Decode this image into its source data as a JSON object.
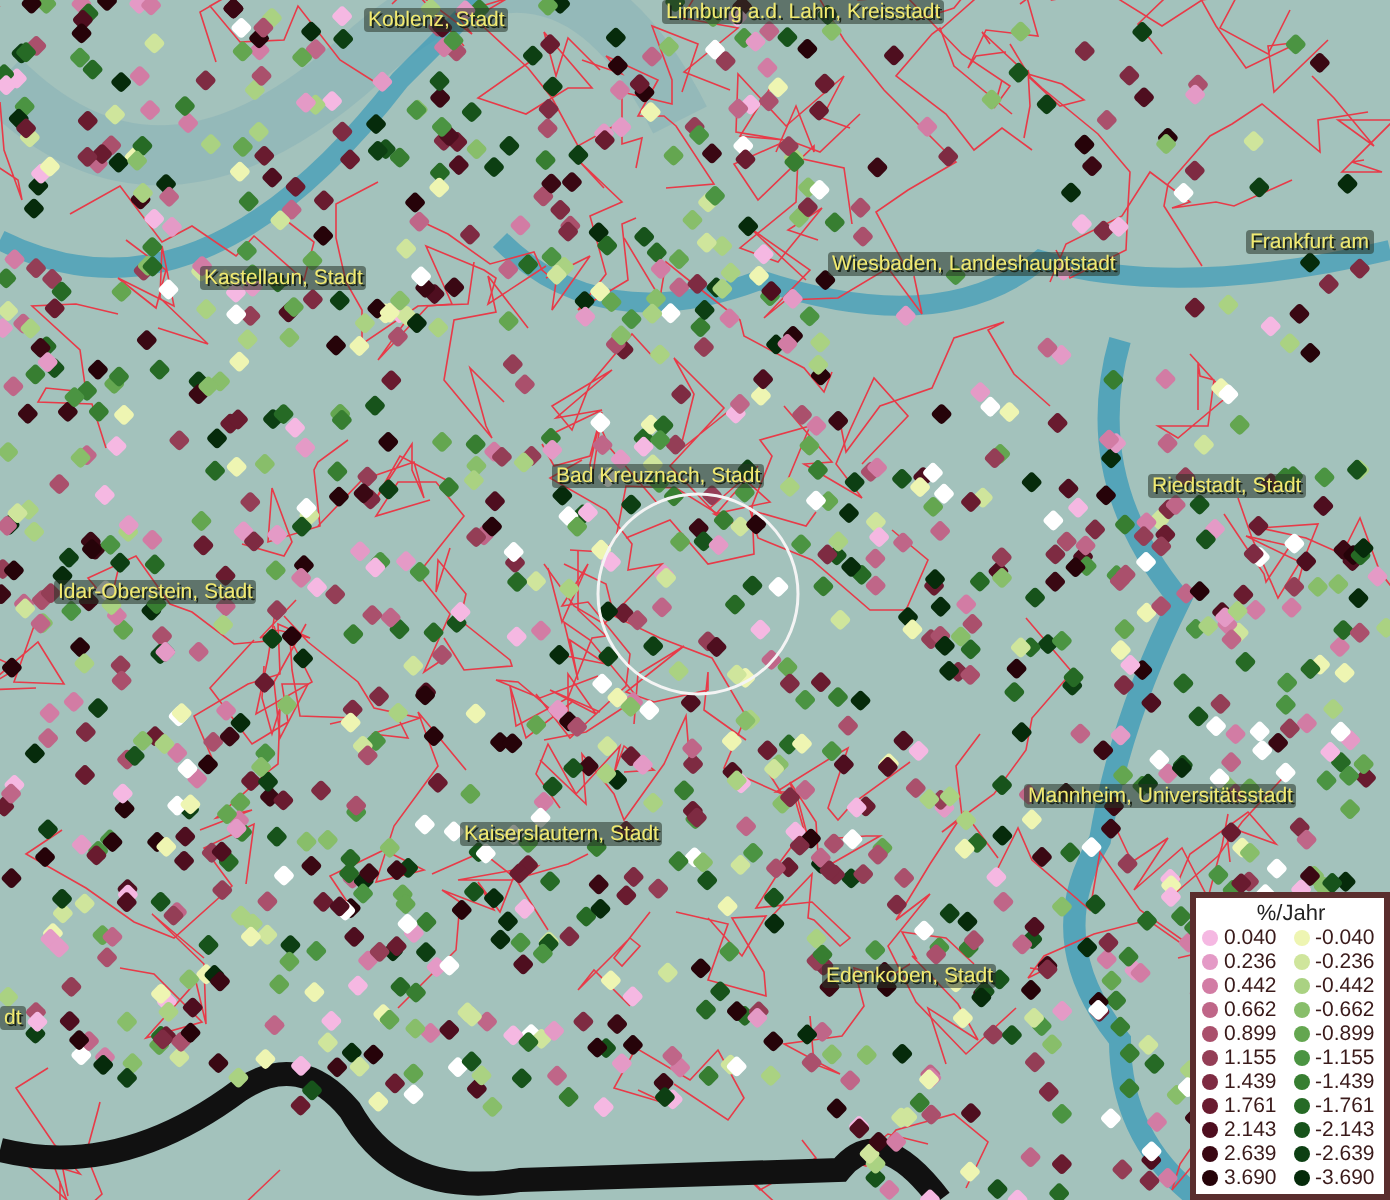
{
  "map": {
    "places": [
      {
        "name": "Koblenz, Stadt"
      },
      {
        "name": "Limburg a.d. Lahn, Kreisstadt"
      },
      {
        "name": "Frankfurt am"
      },
      {
        "name": "Wiesbaden, Landeshauptstadt"
      },
      {
        "name": "Kastellaun, Stadt"
      },
      {
        "name": "Bad Kreuznach, Stadt"
      },
      {
        "name": "Riedstadt, Stadt"
      },
      {
        "name": "Idar-Oberstein, Stadt"
      },
      {
        "name": "Mannheim, Universitätsstadt"
      },
      {
        "name": "Kaiserslautern, Stadt"
      },
      {
        "name": "Edenkoben, Stadt"
      },
      {
        "name": "dt"
      }
    ]
  },
  "legend": {
    "title": "%/Jahr",
    "rows": [
      {
        "positive": {
          "label": "0.040",
          "color": "#f5b8e2"
        },
        "negative": {
          "label": "-0.040",
          "color": "#eef5b2"
        }
      },
      {
        "positive": {
          "label": "0.236",
          "color": "#e49ac6"
        },
        "negative": {
          "label": "-0.236",
          "color": "#cfe59c"
        }
      },
      {
        "positive": {
          "label": "0.442",
          "color": "#d27ca4"
        },
        "negative": {
          "label": "-0.442",
          "color": "#aad282"
        }
      },
      {
        "positive": {
          "label": "0.662",
          "color": "#bf6688"
        },
        "negative": {
          "label": "-0.662",
          "color": "#88be6a"
        }
      },
      {
        "positive": {
          "label": "0.899",
          "color": "#aa506c"
        },
        "negative": {
          "label": "-0.899",
          "color": "#64a650"
        }
      },
      {
        "positive": {
          "label": "1.155",
          "color": "#943e56"
        },
        "negative": {
          "label": "-1.155",
          "color": "#4b9442"
        }
      },
      {
        "positive": {
          "label": "1.439",
          "color": "#7e2b42"
        },
        "negative": {
          "label": "-1.439",
          "color": "#377e31"
        }
      },
      {
        "positive": {
          "label": "1.761",
          "color": "#691b2f"
        },
        "negative": {
          "label": "-1.761",
          "color": "#266a25"
        }
      },
      {
        "positive": {
          "label": "2.143",
          "color": "#4e0e1f"
        },
        "negative": {
          "label": "-2.143",
          "color": "#17531b"
        }
      },
      {
        "positive": {
          "label": "2.639",
          "color": "#3a0813"
        },
        "negative": {
          "label": "-2.639",
          "color": "#0d3f13"
        }
      },
      {
        "positive": {
          "label": "3.690",
          "color": "#260309"
        },
        "negative": {
          "label": "-3.690",
          "color": "#062b0b"
        }
      }
    ]
  }
}
